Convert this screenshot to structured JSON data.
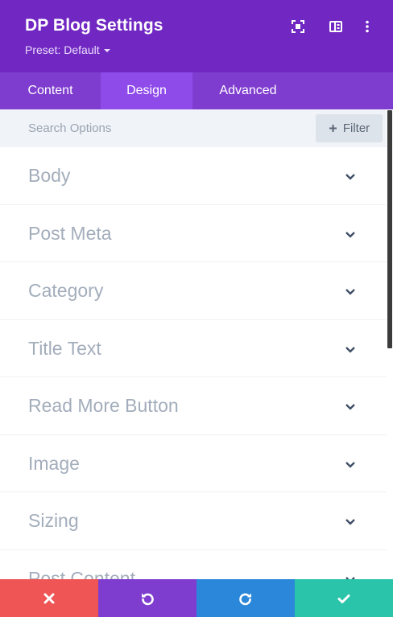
{
  "header": {
    "title": "DP Blog Settings",
    "preset_label": "Preset: Default",
    "icons": [
      "focus-icon",
      "sidebar-layout-icon",
      "more-vertical-icon"
    ],
    "bg_color": "#7128c2"
  },
  "tabs": [
    {
      "label": "Content",
      "active": false
    },
    {
      "label": "Design",
      "active": true
    },
    {
      "label": "Advanced",
      "active": false
    }
  ],
  "search": {
    "placeholder": "Search Options",
    "value": "",
    "filter_label": "Filter"
  },
  "sections": [
    {
      "label": "Body"
    },
    {
      "label": "Post Meta"
    },
    {
      "label": "Category"
    },
    {
      "label": "Title Text"
    },
    {
      "label": "Read More Button"
    },
    {
      "label": "Image"
    },
    {
      "label": "Sizing"
    },
    {
      "label": "Post Content"
    }
  ],
  "footer": {
    "buttons": [
      {
        "name": "discard-button",
        "icon": "close-icon",
        "color": "#ef5555"
      },
      {
        "name": "undo-button",
        "icon": "undo-icon",
        "color": "#7f3dcf"
      },
      {
        "name": "redo-button",
        "icon": "redo-icon",
        "color": "#2b87da"
      },
      {
        "name": "save-button",
        "icon": "check-icon",
        "color": "#29c4a9"
      }
    ]
  }
}
